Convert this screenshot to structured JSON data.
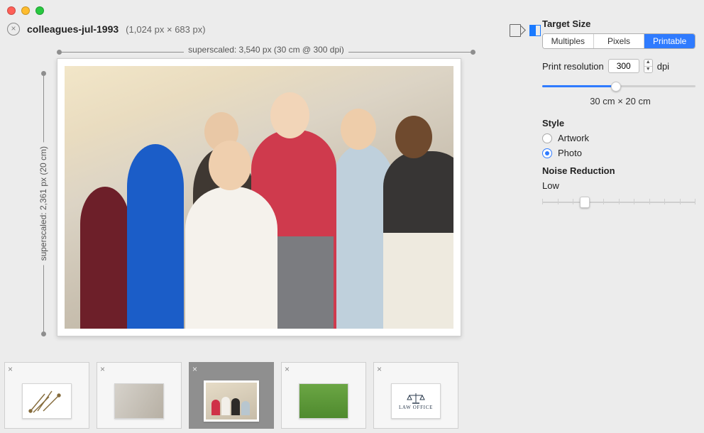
{
  "window": {
    "filename": "colleagues-jul-1993",
    "dimensions_label": "(1,024 px × 683 px)"
  },
  "ruler": {
    "horizontal": "superscaled: 3,540 px (30 cm @ 300 dpi)",
    "vertical": "superscaled: 2,361 px (20 cm)"
  },
  "panel": {
    "target_size_heading": "Target Size",
    "tabs": {
      "multiples": "Multiples",
      "pixels": "Pixels",
      "printable": "Printable",
      "active": "printable"
    },
    "print_res_label": "Print resolution",
    "print_res_value": "300",
    "print_res_unit": "dpi",
    "size_slider_percent": 48,
    "size_caption": "30 cm × 20 cm",
    "style_heading": "Style",
    "style_options": {
      "artwork": "Artwork",
      "photo": "Photo",
      "selected": "photo"
    },
    "noise_heading": "Noise Reduction",
    "noise_level_label": "Low",
    "noise_slider_percent": 28
  },
  "thumbnails": {
    "close_glyph": "×",
    "items": [
      {
        "id": "tools",
        "alt": "antique tools"
      },
      {
        "id": "office",
        "alt": "office interior"
      },
      {
        "id": "people",
        "alt": "colleagues group photo",
        "active": true
      },
      {
        "id": "kittens",
        "alt": "kittens on grass"
      },
      {
        "id": "law",
        "alt": "Law Office logo",
        "caption": "LAW OFFICE"
      }
    ]
  }
}
